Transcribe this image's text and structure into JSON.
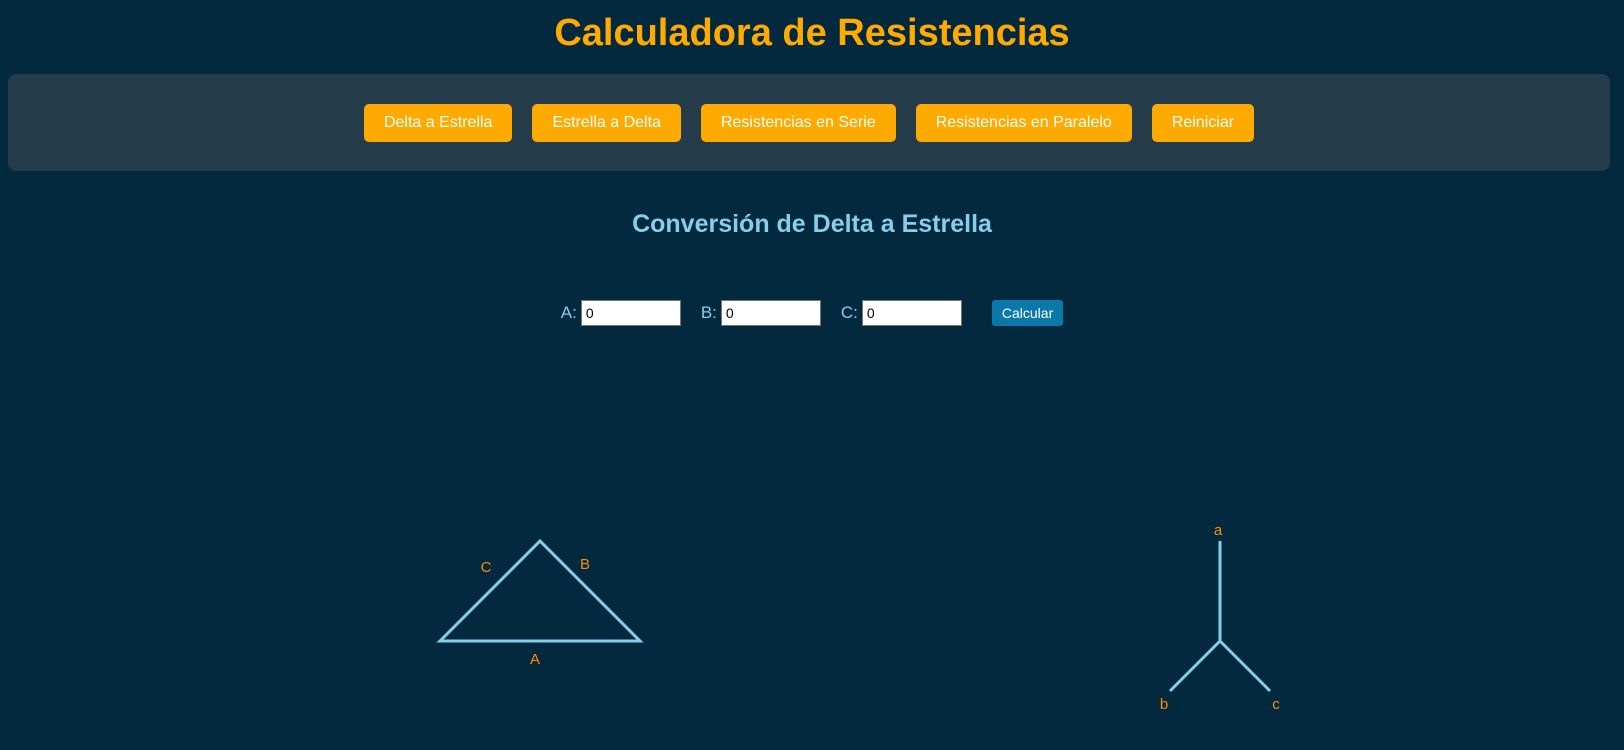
{
  "header": {
    "title": "Calculadora de Resistencias"
  },
  "toolbar": {
    "buttons": [
      {
        "label": "Delta a Estrella"
      },
      {
        "label": "Estrella a Delta"
      },
      {
        "label": "Resistencias en Serie"
      },
      {
        "label": "Resistencias en Paralelo"
      },
      {
        "label": "Reiniciar"
      }
    ]
  },
  "section": {
    "title": "Conversión de Delta a Estrella"
  },
  "form": {
    "fields": [
      {
        "label": "A:",
        "value": "0"
      },
      {
        "label": "B:",
        "value": "0"
      },
      {
        "label": "C:",
        "value": "0"
      }
    ],
    "calculate_label": "Calcular"
  },
  "delta_diagram": {
    "labels": {
      "a": "A",
      "b": "B",
      "c": "C"
    }
  },
  "star_diagram": {
    "labels": {
      "a": "a",
      "b": "b",
      "c": "c"
    }
  },
  "colors": {
    "background": "#03293f",
    "accent": "#ffaa00",
    "secondary": "#87ceeb",
    "label": "#ff8c00",
    "calculate_button": "#0a79a9"
  }
}
